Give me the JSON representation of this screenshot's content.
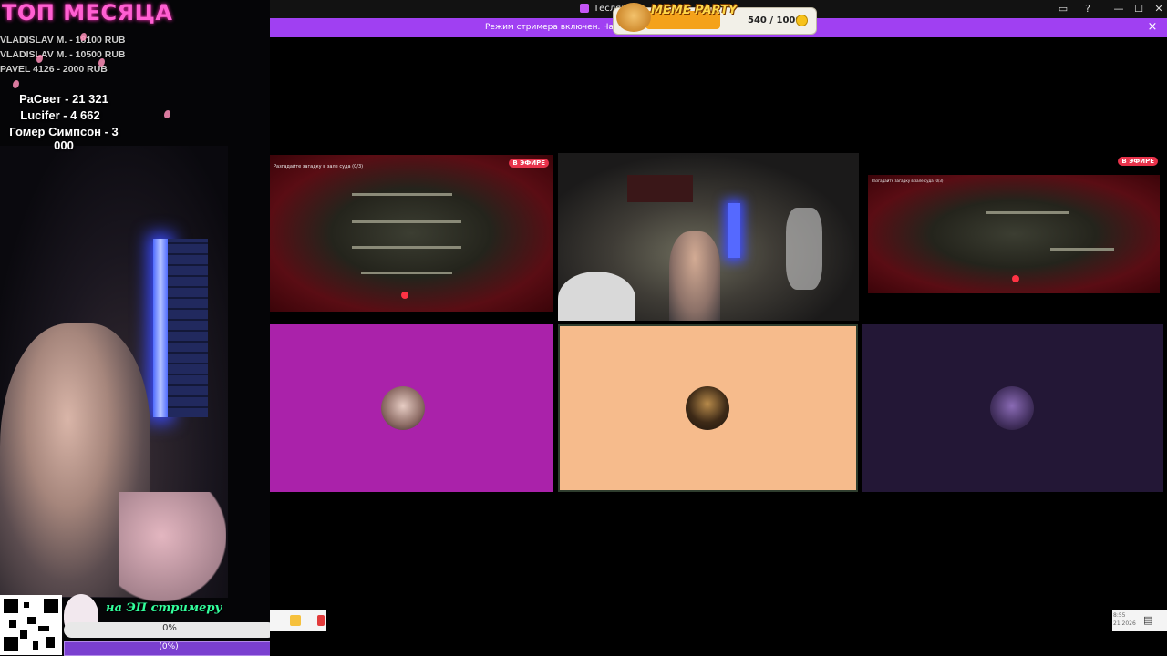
{
  "overlay": {
    "title": "ТОП МЕСЯЦА",
    "donors": [
      "VLADISLAV M. - 18100 RUB",
      "VLADISLAV M. - 10500 RUB",
      "PAVEL 4126 - 2000 RUB"
    ],
    "subs": [
      "РаСвет - 21 321",
      "Lucifer - 4 662",
      "Гомер Симпсон - 3 000"
    ],
    "promo_text": "на ЭП стримеру",
    "progress1_label": "0%",
    "progress2_label": "(0%)"
  },
  "app": {
    "title": "Теслян",
    "banner_text": "Режим стримера включен. Часть имен",
    "banner_close": "×",
    "window_controls": [
      "—",
      "☐",
      "✕"
    ],
    "top_icons": [
      "monitor-icon",
      "help-icon"
    ]
  },
  "meme_party": {
    "title": "MEME PARTY",
    "count": "540 / 1000"
  },
  "tiles": {
    "live_label": "В ЭФИРЕ",
    "colors": {
      "tile4": "#aa22aa",
      "tile5": "#f6bb8c",
      "tile6": "#231736"
    }
  },
  "tray": {
    "time": "8:55",
    "date": "21.2026"
  }
}
